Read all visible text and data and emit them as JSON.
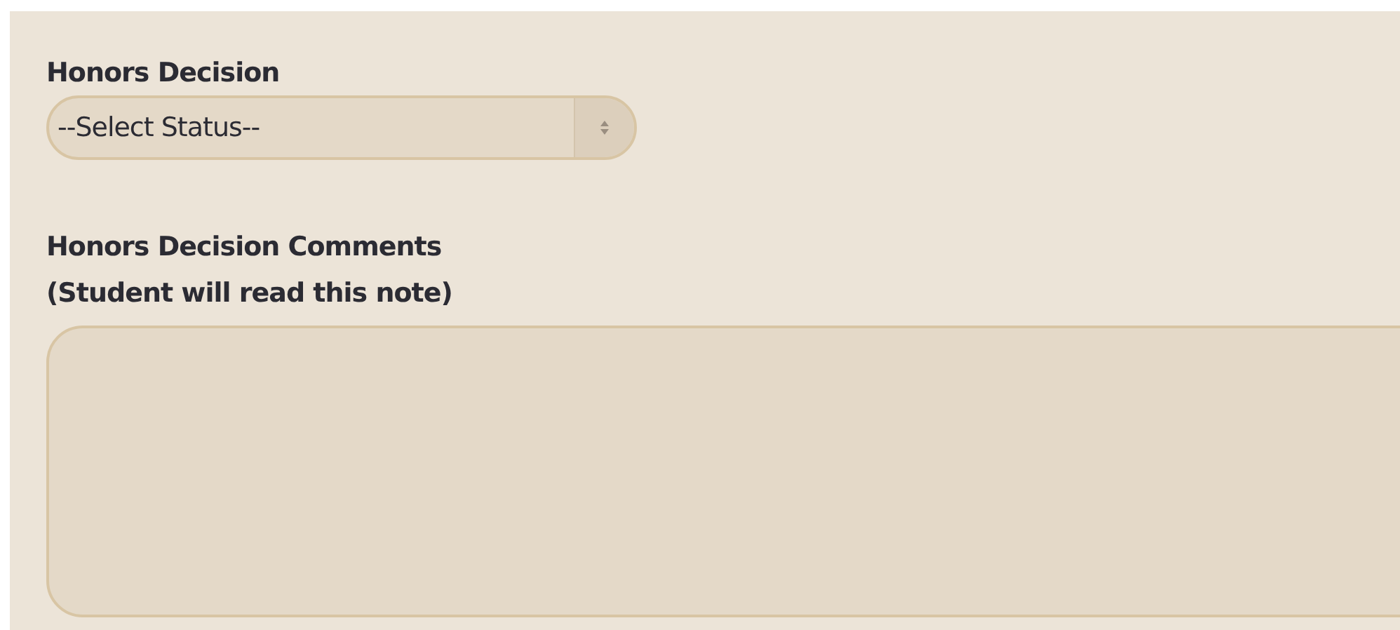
{
  "decision": {
    "label": "Honors Decision",
    "select": {
      "value": "--Select Status--"
    }
  },
  "comments": {
    "label_lines": [
      "Honors Decision Comments",
      "(Student will read this note)"
    ]
  }
}
